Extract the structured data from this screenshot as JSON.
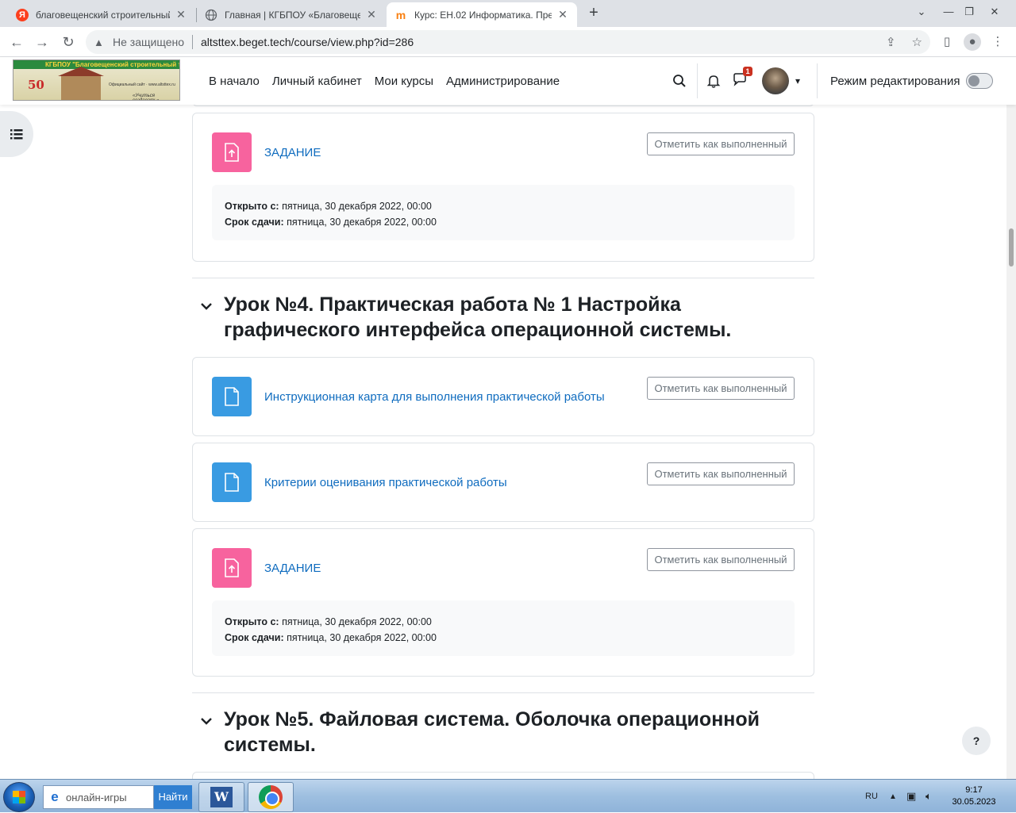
{
  "browser": {
    "tabs": [
      {
        "title": "благовещенский строительный",
        "favicon": "Я",
        "active": false
      },
      {
        "title": "Главная | КГБПОУ «Благовещен",
        "favicon": "globe-icon",
        "active": false
      },
      {
        "title": "Курс: ЕН.02 Информатика. Пре",
        "favicon": "m",
        "active": true
      }
    ],
    "address": {
      "security_label": "Не защищено",
      "url": "altsttex.beget.tech/course/view.php?id=286"
    }
  },
  "navbar": {
    "logo_text": "КГБПОУ \"Благовещенский строительный техникум\"",
    "logo_number": "50",
    "logo_sub": "Официальный сайт · www.altsttex.ru",
    "logo_motto": "«Учиться создавать»",
    "links": [
      "В начало",
      "Личный кабинет",
      "Мои курсы",
      "Администрирование"
    ],
    "messages_badge": "1",
    "edit_mode_label": "Режим редактирования",
    "edit_mode_on": false
  },
  "content": {
    "done_label": "Отметить как выполненный",
    "top_assignment": {
      "title": "ЗАДАНИЕ",
      "opened_label": "Открыто с:",
      "opened_value": "пятница, 30 декабря 2022, 00:00",
      "due_label": "Срок сдачи:",
      "due_value": "пятница, 30 декабря 2022, 00:00"
    },
    "section4": {
      "title": "Урок №4. Практическая работа № 1 Настройка графического интерфейса операционной системы.",
      "activities": [
        {
          "type": "resource",
          "title": "Инструкционная карта для выполнения практической работы"
        },
        {
          "type": "resource",
          "title": "Критерии оценивания практической работы"
        }
      ],
      "assignment": {
        "title": "ЗАДАНИЕ",
        "opened_label": "Открыто с:",
        "opened_value": "пятница, 30 декабря 2022, 00:00",
        "due_label": "Срок сдачи:",
        "due_value": "пятница, 30 декабря 2022, 00:00"
      }
    },
    "section5": {
      "title": "Урок №5. Файловая система. Оболочка операционной системы."
    },
    "help_label": "?"
  },
  "taskbar": {
    "search_text": "онлайн-игры",
    "search_button": "Найти",
    "language": "RU",
    "time": "9:17",
    "date": "30.05.2023"
  }
}
